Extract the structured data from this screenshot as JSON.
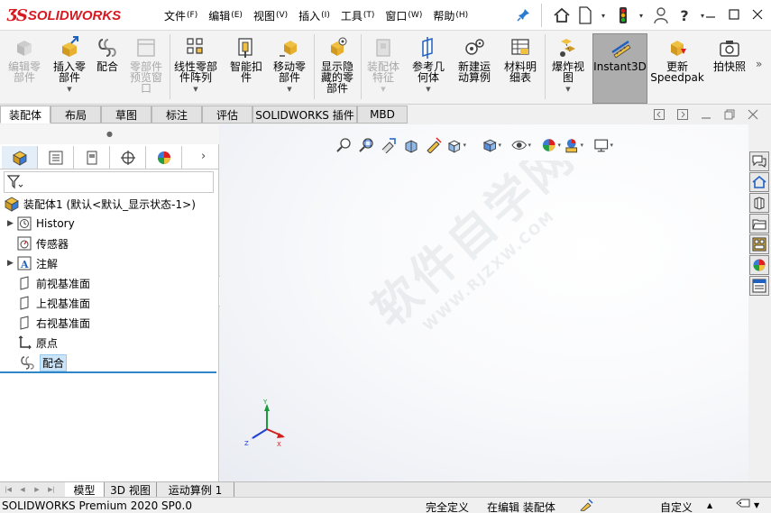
{
  "app": {
    "logo_text": "SOLIDWORKS",
    "brand_color": "#d71920"
  },
  "menu": {
    "items": [
      {
        "label": "文件",
        "key": "(F)"
      },
      {
        "label": "编辑",
        "key": "(E)"
      },
      {
        "label": "视图",
        "key": "(V)"
      },
      {
        "label": "插入",
        "key": "(I)"
      },
      {
        "label": "工具",
        "key": "(T)"
      },
      {
        "label": "窗口",
        "key": "(W)"
      },
      {
        "label": "帮助",
        "key": "(H)"
      }
    ],
    "help_symbol": "?"
  },
  "ribbon": {
    "buttons": [
      {
        "label": "编辑零\n部件",
        "icon": "edit-component-icon",
        "disabled": true
      },
      {
        "label": "插入零\n部件",
        "icon": "insert-component-icon",
        "disabled": false
      },
      {
        "label": "配合",
        "icon": "mate-icon",
        "disabled": false
      },
      {
        "label": "零部件\n预览窗\n口",
        "icon": "component-preview-icon",
        "disabled": true
      },
      {
        "label": "线性零部\n件阵列",
        "icon": "linear-pattern-icon",
        "disabled": false
      },
      {
        "label": "智能扣\n件",
        "icon": "smart-fasteners-icon",
        "disabled": false
      },
      {
        "label": "移动零\n部件",
        "icon": "move-component-icon",
        "disabled": false
      },
      {
        "label": "显示隐\n藏的零\n部件",
        "icon": "show-hidden-icon",
        "disabled": false
      },
      {
        "label": "装配体\n特征",
        "icon": "assembly-features-icon",
        "disabled": true
      },
      {
        "label": "参考几\n何体",
        "icon": "reference-geometry-icon",
        "disabled": false
      },
      {
        "label": "新建运\n动算例",
        "icon": "new-motion-study-icon",
        "disabled": false
      },
      {
        "label": "材料明\n细表",
        "icon": "bom-icon",
        "disabled": false
      },
      {
        "label": "爆炸视\n图",
        "icon": "exploded-view-icon",
        "disabled": false
      },
      {
        "label": "Instant3D",
        "icon": "instant3d-icon",
        "disabled": false
      },
      {
        "label": "更新\nSpeedpak",
        "icon": "speedpak-icon",
        "disabled": false
      },
      {
        "label": "拍快照",
        "icon": "snapshot-icon",
        "disabled": false
      }
    ],
    "more_symbol": "»"
  },
  "command_tabs": [
    "装配体",
    "布局",
    "草图",
    "标注",
    "评估",
    "SOLIDWORKS 插件",
    "MBD"
  ],
  "feature_tree": {
    "root": "装配体1 (默认<默认_显示状态-1>)",
    "items": [
      {
        "label": "History",
        "icon": "history-icon",
        "expandable": true
      },
      {
        "label": "传感器",
        "icon": "sensor-icon",
        "expandable": false
      },
      {
        "label": "注解",
        "icon": "annotations-icon",
        "expandable": true
      },
      {
        "label": "前视基准面",
        "icon": "plane-icon",
        "expandable": false
      },
      {
        "label": "上视基准面",
        "icon": "plane-icon",
        "expandable": false
      },
      {
        "label": "右视基准面",
        "icon": "plane-icon",
        "expandable": false
      },
      {
        "label": "原点",
        "icon": "origin-icon",
        "expandable": false
      },
      {
        "label": "配合",
        "icon": "mates-icon",
        "expandable": false
      }
    ]
  },
  "watermark": {
    "line1": "软件自学网",
    "line2": "WWW.RJZXW.COM"
  },
  "triad": {
    "x": "X",
    "y": "Y",
    "z": "Z"
  },
  "bottom_tabs": [
    "模型",
    "3D 视图",
    "运动算例 1"
  ],
  "status": {
    "product": "SOLIDWORKS Premium 2020 SP0.0",
    "definition": "完全定义",
    "editing": "在编辑 装配体",
    "custom": "自定义"
  }
}
